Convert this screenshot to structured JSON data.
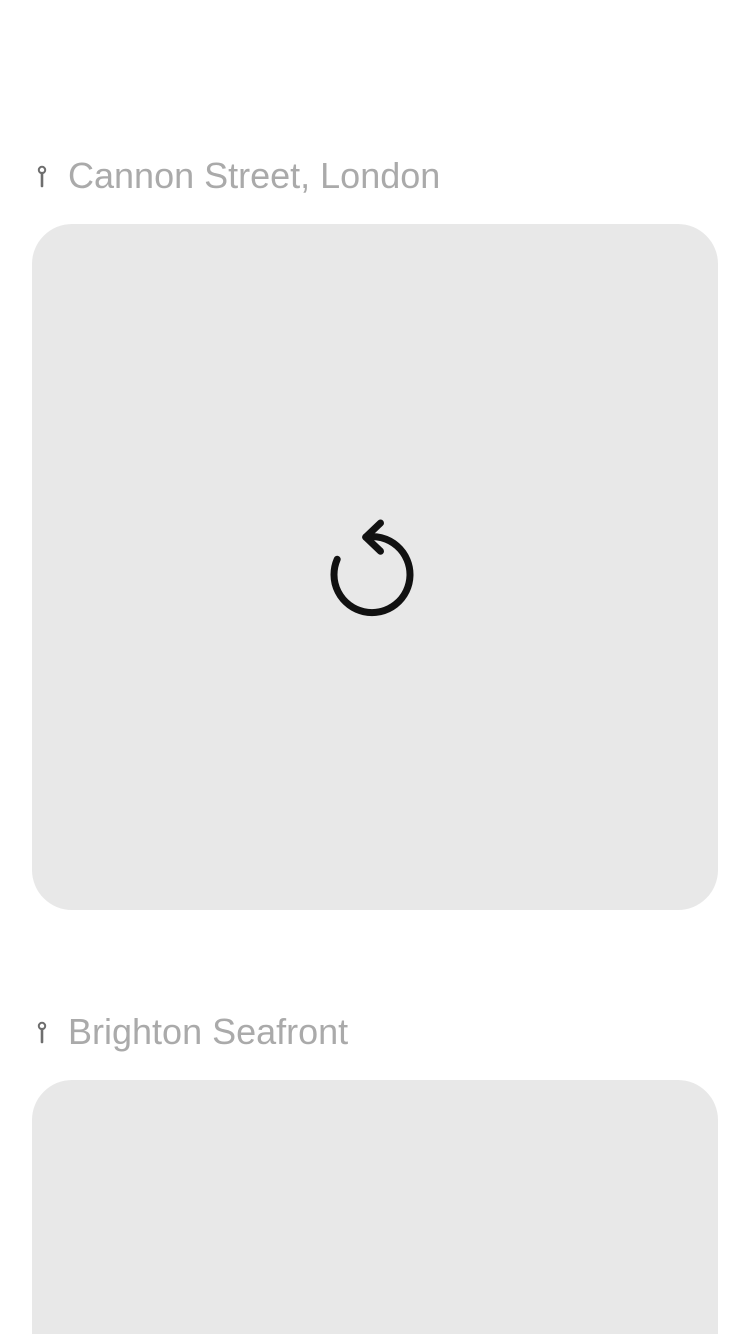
{
  "feed": {
    "items": [
      {
        "location": "Cannon Street, London",
        "pin_icon": "map-pin-icon",
        "photo_state": "reload",
        "reload_icon": "reload-icon"
      },
      {
        "location": "Brighton Seafront",
        "pin_icon": "map-pin-icon",
        "photo_state": "placeholder"
      }
    ]
  },
  "colors": {
    "background": "#ffffff",
    "card": "#e8e8e8",
    "location_text": "#aaaaaa",
    "icon": "#111111",
    "pin": "#6e6e6e"
  }
}
